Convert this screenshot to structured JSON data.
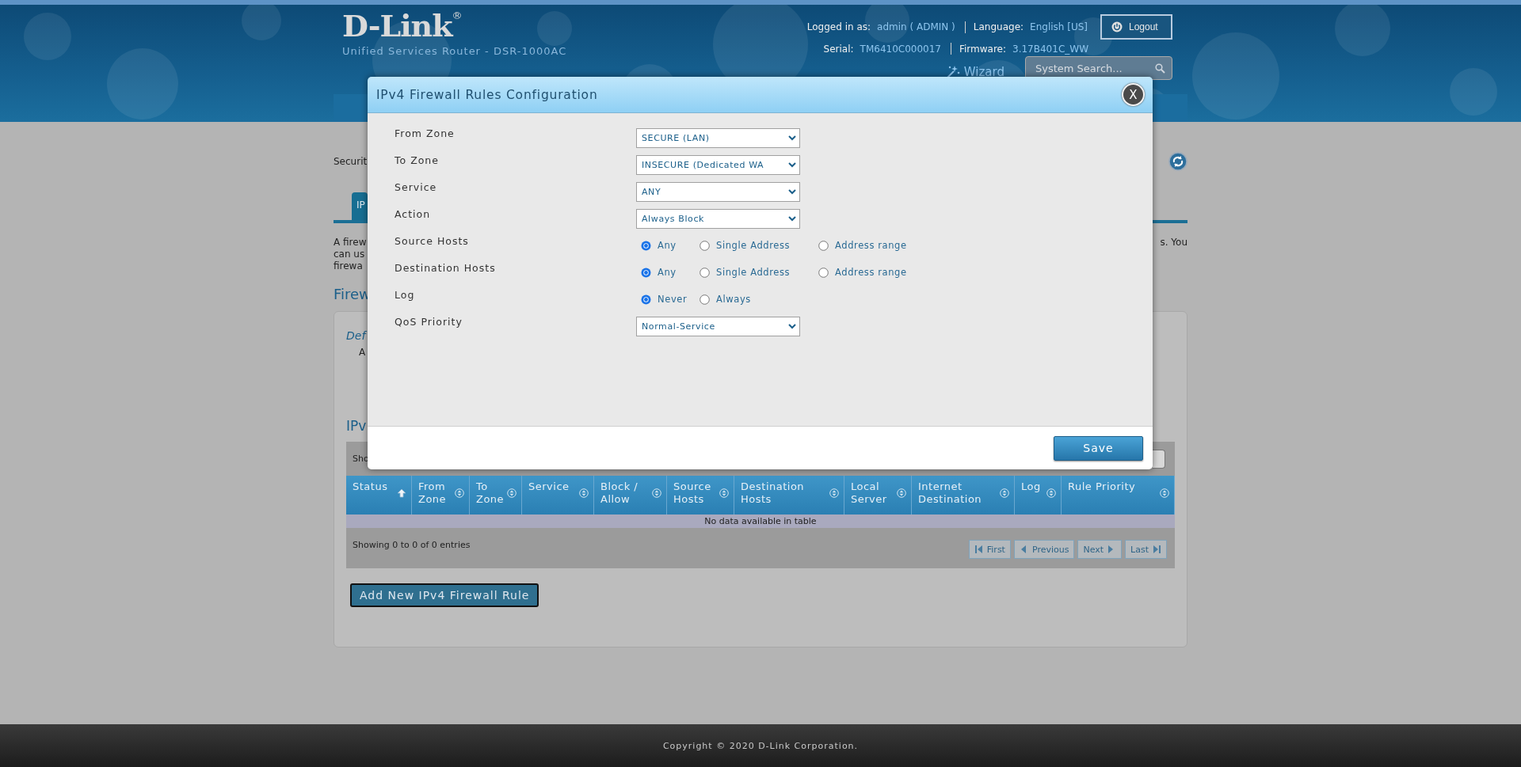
{
  "header": {
    "logo": "D-Link",
    "logo_mark": "®",
    "subtitle": "Unified Services Router - DSR-1000AC",
    "account": [
      {
        "label": "Logged in as:",
        "value": "admin ( ADMIN )"
      },
      {
        "label": "Language:",
        "value": "English [US]"
      }
    ],
    "device": [
      {
        "label": "Serial:",
        "value": "TM6410C000017"
      },
      {
        "label": "Firmware:",
        "value": "3.17B401C_WW"
      }
    ],
    "logout": "Logout",
    "wizard": "Wizard",
    "search": {
      "placeholder": "System Search..."
    }
  },
  "page": {
    "breadcrumb": "Securit",
    "tabs": [
      {
        "label": "IP",
        "selected": true
      }
    ],
    "intro_lines": [
      "A firew",
      "can us",
      "firewa"
    ],
    "intro_right": "s. You",
    "section_title": "Firew",
    "policy_title": "Def",
    "policy_text": "A",
    "table_title": "IPv",
    "toolbar_text": "Sho",
    "table": {
      "columns": [
        {
          "label": "Status",
          "sorted": true
        },
        {
          "label": "From Zone",
          "sorted": false
        },
        {
          "label": "To Zone",
          "sorted": false
        },
        {
          "label": "Service",
          "sorted": false
        },
        {
          "label": "Block / Allow",
          "sorted": false
        },
        {
          "label": "Source Hosts",
          "sorted": false
        },
        {
          "label": "Destination Hosts",
          "sorted": false
        },
        {
          "label": "Local Server",
          "sorted": false
        },
        {
          "label": "Internet Destination",
          "sorted": false
        },
        {
          "label": "Log",
          "sorted": false
        },
        {
          "label": "Rule Priority",
          "sorted": false
        }
      ],
      "empty_text": "No data available in table",
      "info": "Showing 0 to 0 of 0 entries",
      "pager": [
        {
          "label": "First",
          "kind": "first",
          "disabled": true
        },
        {
          "label": "Previous",
          "kind": "previous",
          "disabled": true
        },
        {
          "label": "Next",
          "kind": "next",
          "disabled": true
        },
        {
          "label": "Last",
          "kind": "last",
          "disabled": true
        }
      ]
    },
    "add_button": "Add New IPv4 Firewall Rule"
  },
  "dialog": {
    "title": "IPv4 Firewall Rules Configuration",
    "close": "X",
    "fields": [
      {
        "label": "From Zone",
        "kind": "select",
        "value": "SECURE (LAN)"
      },
      {
        "label": "To Zone",
        "kind": "select",
        "value": "INSECURE (Dedicated WA"
      },
      {
        "label": "Service",
        "kind": "select",
        "value": "ANY"
      },
      {
        "label": "Action",
        "kind": "select",
        "value": "Always Block"
      },
      {
        "label": "Source Hosts",
        "kind": "radio",
        "options": [
          {
            "label": "Any",
            "selected": true
          },
          {
            "label": "Single Address",
            "selected": false
          },
          {
            "label": "Address range",
            "selected": false
          }
        ]
      },
      {
        "label": "Destination Hosts",
        "kind": "radio",
        "options": [
          {
            "label": "Any",
            "selected": true
          },
          {
            "label": "Single Address",
            "selected": false
          },
          {
            "label": "Address range",
            "selected": false
          }
        ]
      },
      {
        "label": "Log",
        "kind": "radio",
        "options": [
          {
            "label": "Never",
            "selected": true
          },
          {
            "label": "Always",
            "selected": false
          }
        ]
      },
      {
        "label": "QoS Priority",
        "kind": "select",
        "value": "Normal-Service"
      }
    ],
    "save": "Save"
  },
  "footer": {
    "copyright": "Copyright © 2020 D-Link Corporation."
  }
}
